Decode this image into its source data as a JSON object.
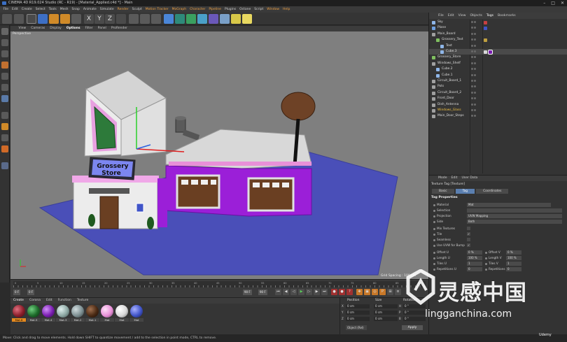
{
  "window": {
    "title": "CINEMA 4D R19.024 Studio (RC - R19) - [Material_Applied.c4d *] - Main",
    "controls": [
      "–",
      "□",
      "✕"
    ]
  },
  "menubar": {
    "items": [
      "File",
      "Edit",
      "Create",
      "Select",
      "Tools",
      "Mesh",
      "Snap",
      "Animate",
      "Simulate",
      "Render",
      "Sculpt",
      "Motion Tracker",
      "MoGraph",
      "Character",
      "Pipeline",
      "Plugins",
      "Octane",
      "Script",
      "Window",
      "Help"
    ],
    "layout_label": "Layout:",
    "layout_value": "Startup"
  },
  "viewport": {
    "menu": [
      "View",
      "Cameras",
      "Display",
      "Options",
      "Filter",
      "Panel",
      "ProRender"
    ],
    "active_menu": "Options",
    "label": "Perspective",
    "sign_line1": "Grossery",
    "sign_line2": "Store",
    "grid_spacing": "Grid Spacing : 100 cm"
  },
  "timeline": {
    "ticks": [
      "0",
      "5",
      "10",
      "15",
      "20",
      "25",
      "30",
      "35",
      "40",
      "45",
      "50",
      "55",
      "60",
      "65",
      "70",
      "75",
      "80",
      "85",
      "90"
    ],
    "start_frame": "0 F",
    "current_frame": "0 F",
    "end_frame": "90 F",
    "end_frame2": "90 F"
  },
  "materials": {
    "menu": [
      "Create",
      "Corona",
      "Edit",
      "Function",
      "Texture"
    ],
    "items": [
      {
        "name": "Mat.6",
        "color": "#8a1e2a",
        "selected": true
      },
      {
        "name": "Mat.5",
        "color": "#1d6a2a",
        "selected": false
      },
      {
        "name": "Mat.4",
        "color": "#7a1db0",
        "selected": false
      },
      {
        "name": "Mat.3",
        "color": "#8ea8a4",
        "selected": false
      },
      {
        "name": "Mat.2",
        "color": "#7d8f92",
        "selected": false
      },
      {
        "name": "Mat.1",
        "color": "#4a2a14",
        "selected": false
      },
      {
        "name": "Mat",
        "color": "#e890d8",
        "selected": false
      },
      {
        "name": "Mat",
        "color": "#d8d8d8",
        "selected": false
      },
      {
        "name": "Mat",
        "color": "#4054c8",
        "selected": false
      }
    ]
  },
  "coordinates": {
    "headers": [
      "Position",
      "Size",
      "Rotation"
    ],
    "rows": [
      {
        "axis": "X",
        "pos": "0 cm",
        "size": "0 cm",
        "rot_label": "H",
        "rot": "0 °"
      },
      {
        "axis": "Y",
        "pos": "0 cm",
        "size": "0 cm",
        "rot_label": "P",
        "rot": "0 °"
      },
      {
        "axis": "Z",
        "pos": "0 cm",
        "size": "0 cm",
        "rot_label": "B",
        "rot": "0 °"
      }
    ],
    "mode": "Object (Rel)",
    "apply": "Apply"
  },
  "status": "Move: Click and drag to move elements. Hold down SHIFT to quantize movement / add to the selection in point mode, CTRL to remove.",
  "object_manager": {
    "menu": [
      "File",
      "Edit",
      "View",
      "Objects",
      "Tags",
      "Bookmarks"
    ],
    "objects": [
      {
        "name": "Sky",
        "indent": 0,
        "color": "#8fb6e8",
        "tags": [
          "#c84040"
        ]
      },
      {
        "name": "Plane",
        "indent": 0,
        "color": "#6fa0e0",
        "tags": [
          "#4054c8"
        ]
      },
      {
        "name": "Main_Board",
        "indent": 0,
        "color": "#a0a0a0",
        "tags": []
      },
      {
        "name": "Grossery_Text",
        "indent": 1,
        "color": "#80c060",
        "tags": [
          "#c0a040"
        ]
      },
      {
        "name": "Text",
        "indent": 2,
        "color": "#8fb6e8",
        "tags": []
      },
      {
        "name": "Cube.3",
        "indent": 2,
        "color": "#8fb6e8",
        "tags": [
          "#d8d8d8",
          "#7a1db0"
        ]
      },
      {
        "name": "Grossery_Store",
        "indent": 0,
        "color": "#80c060",
        "tags": []
      },
      {
        "name": "Windows_Shelf",
        "indent": 0,
        "color": "#a0a0a0",
        "tags": []
      },
      {
        "name": "Cube.2",
        "indent": 1,
        "color": "#8fb6e8",
        "tags": []
      },
      {
        "name": "Cube.1",
        "indent": 1,
        "color": "#8fb6e8",
        "tags": []
      },
      {
        "name": "Circuit_Board_1",
        "indent": 0,
        "color": "#a0a0a0",
        "tags": []
      },
      {
        "name": "Pots",
        "indent": 0,
        "color": "#a0a0a0",
        "tags": []
      },
      {
        "name": "Circuit_Board_2",
        "indent": 0,
        "color": "#a0a0a0",
        "tags": []
      },
      {
        "name": "Front_Door",
        "indent": 0,
        "color": "#a0a0a0",
        "tags": []
      },
      {
        "name": "Dish_Antenna",
        "indent": 0,
        "color": "#a0a0a0",
        "tags": []
      },
      {
        "name": "Windows_Glass",
        "indent": 0,
        "color": "#a0a0a0",
        "tags": [],
        "highlight": true
      },
      {
        "name": "Main_Door_Steps",
        "indent": 0,
        "color": "#a0a0a0",
        "tags": []
      }
    ]
  },
  "attributes": {
    "menu": [
      "Mode",
      "Edit",
      "User Data"
    ],
    "tag_title": "Texture Tag [Texture]",
    "tabs": [
      "Basic",
      "Tag",
      "Coordinates"
    ],
    "active_tab": "Tag",
    "section": "Tag Properties",
    "rows": [
      {
        "label": "Material",
        "value": "Mat"
      },
      {
        "label": "Selection",
        "value": ""
      },
      {
        "label": "Projection",
        "value": "UVW Mapping"
      },
      {
        "label": "Side",
        "value": "Both"
      },
      {
        "label": "Mix Textures",
        "value": ""
      },
      {
        "label": "Tile",
        "value": "✓"
      },
      {
        "label": "Seamless",
        "value": ""
      },
      {
        "label": "Use UVW for Bump",
        "value": "✓"
      }
    ],
    "pairs": [
      {
        "l1": "Offset U",
        "v1": "0 %",
        "l2": "Offset V",
        "v2": "0 %"
      },
      {
        "l1": "Length U",
        "v1": "100 %",
        "l2": "Length V",
        "v2": "100 %"
      },
      {
        "l1": "Tiles U",
        "v1": "1",
        "l2": "Tiles V",
        "v2": "1"
      },
      {
        "l1": "Repetitions U",
        "v1": "0",
        "l2": "Repetitions V",
        "v2": "0"
      }
    ]
  },
  "watermark": {
    "cn": "灵感中国",
    "url": "lingganchina.com",
    "udemy": "Udemy"
  }
}
